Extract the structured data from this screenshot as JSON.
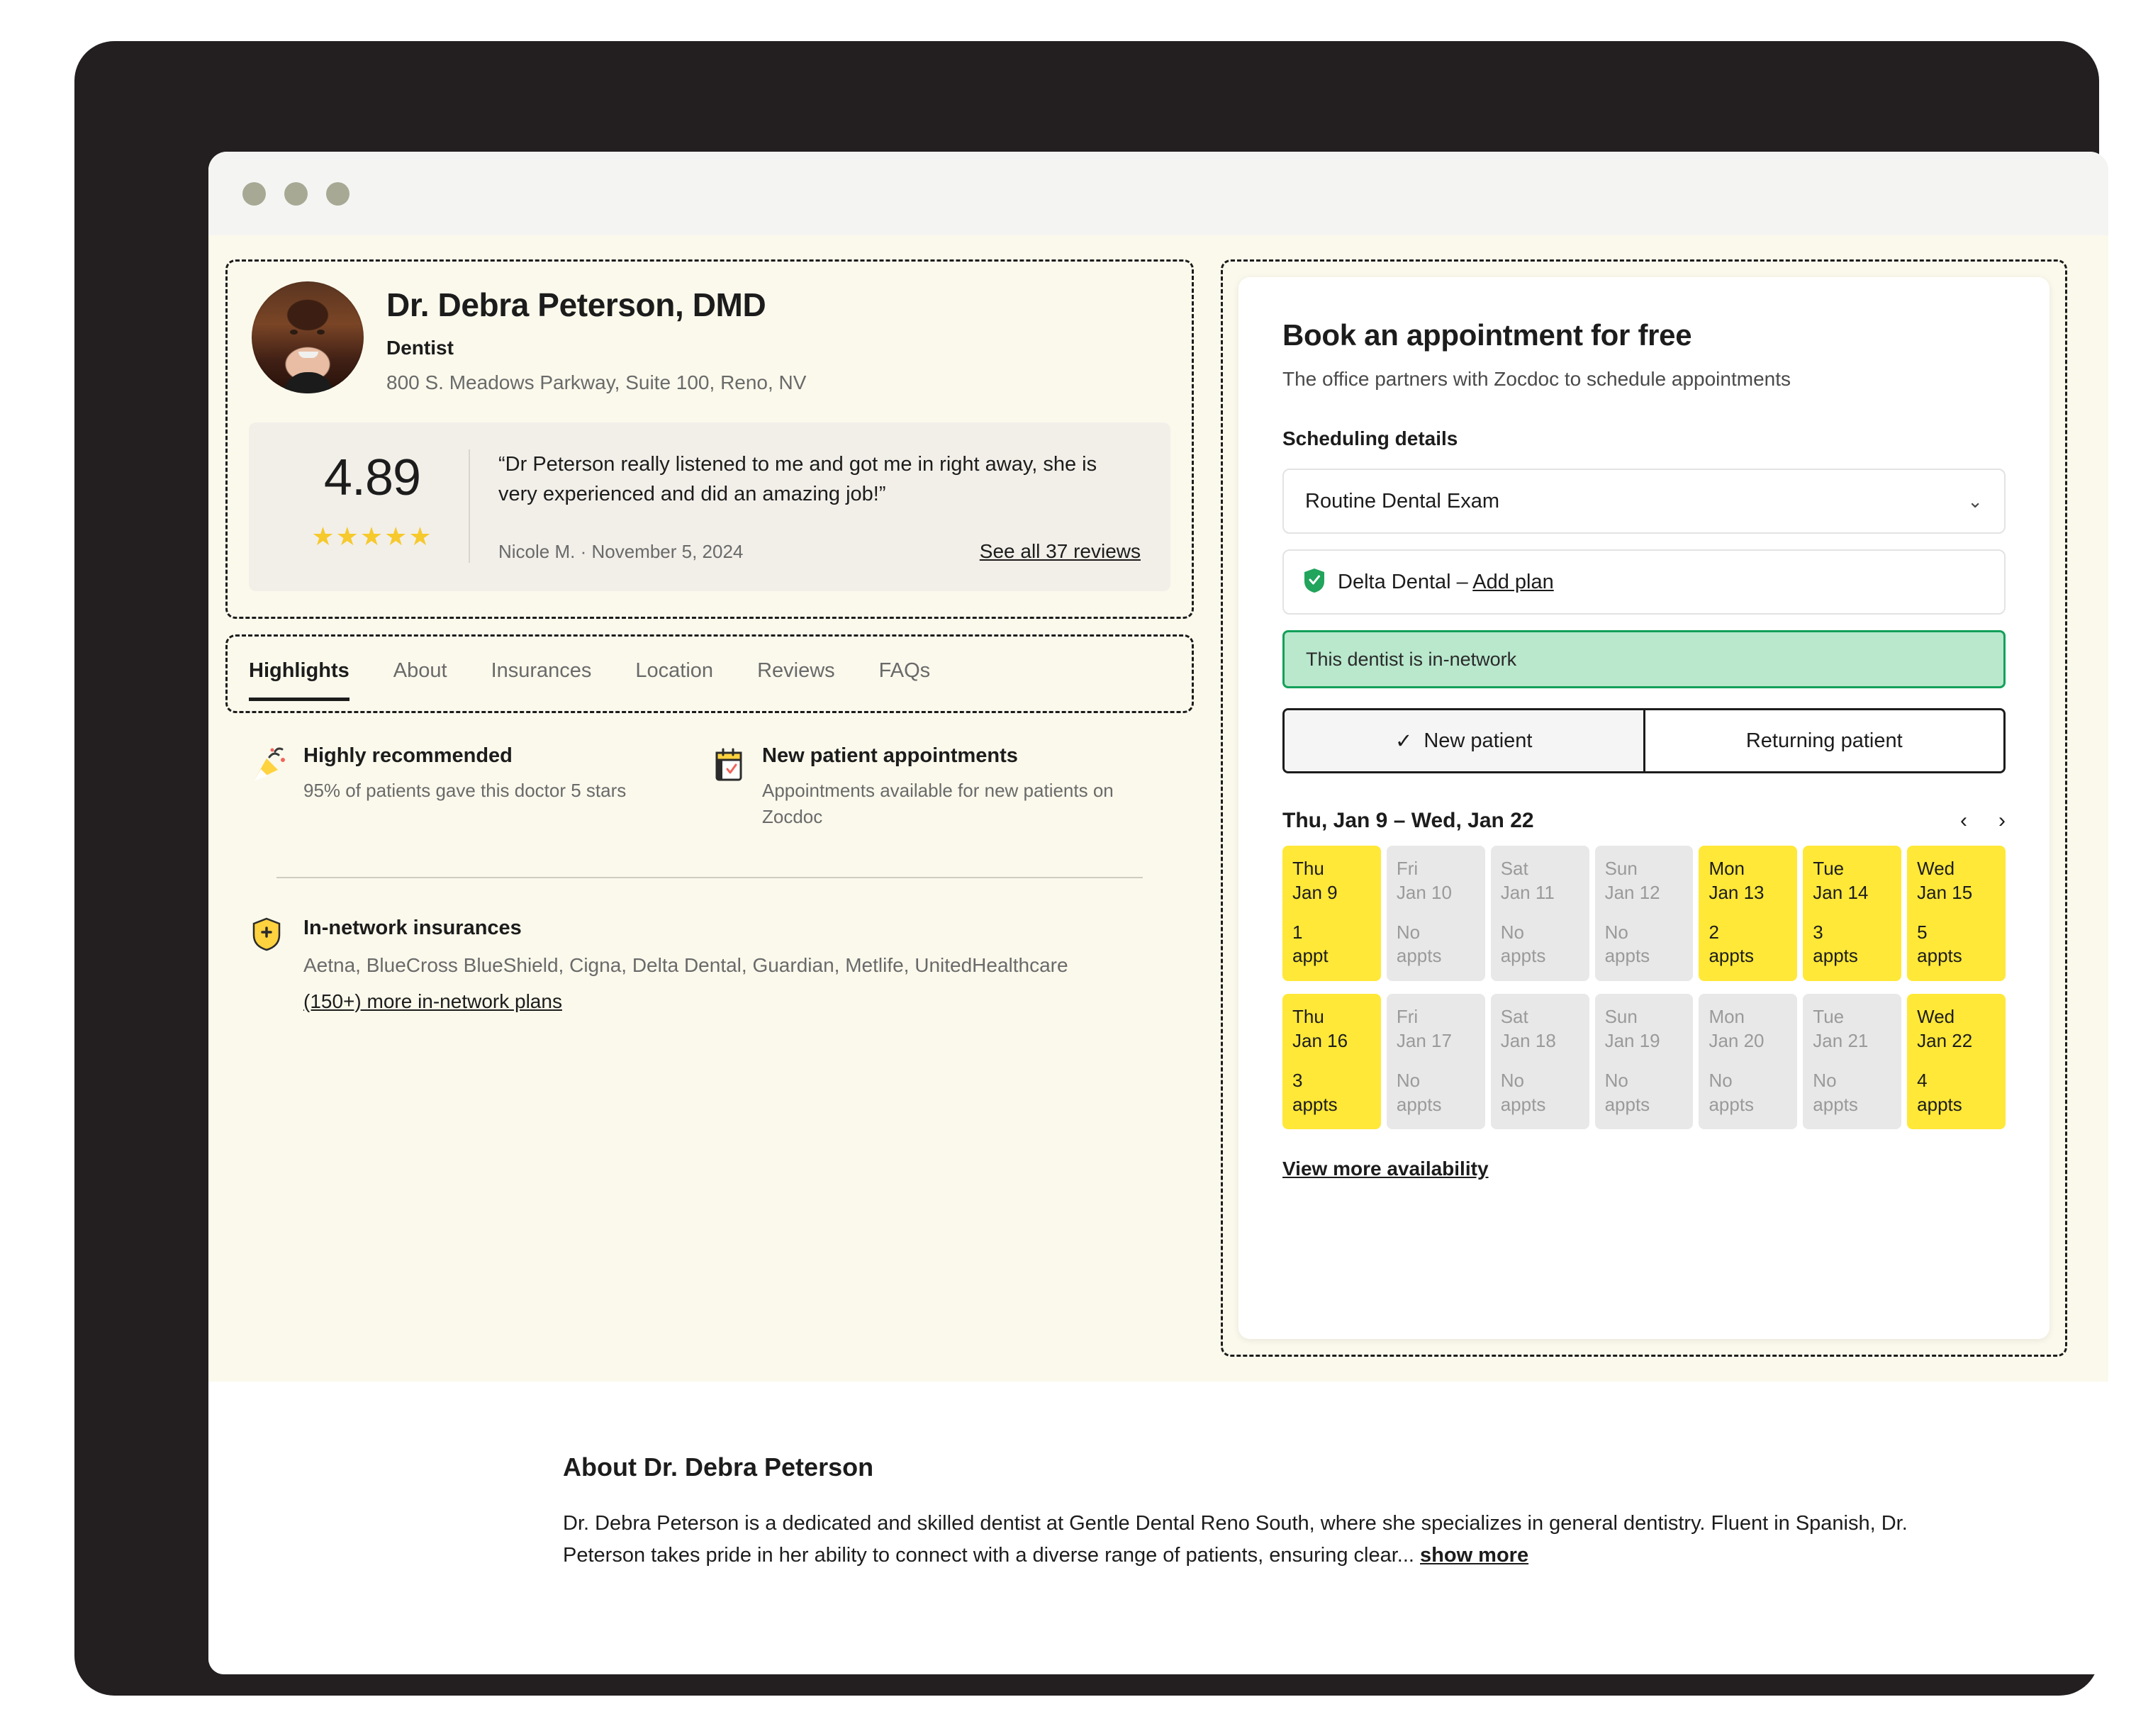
{
  "browser": {
    "dots": [
      "close-dot",
      "minimize-dot",
      "maximize-dot"
    ]
  },
  "profile": {
    "name": "Dr. Debra Peterson, DMD",
    "specialty": "Dentist",
    "address": "800 S. Meadows Parkway, Suite 100, Reno, NV"
  },
  "review": {
    "rating": "4.89",
    "stars": "★★★★★",
    "quote": "“Dr Peterson really listened to me and got me in right away, she is very experienced and did an amazing job!”",
    "author": "Nicole M.  ·  November 5, 2024",
    "see_all": "See all 37 reviews"
  },
  "tabs": [
    {
      "label": "Highlights",
      "active": true
    },
    {
      "label": "About",
      "active": false
    },
    {
      "label": "Insurances",
      "active": false
    },
    {
      "label": "Location",
      "active": false
    },
    {
      "label": "Reviews",
      "active": false
    },
    {
      "label": "FAQs",
      "active": false
    }
  ],
  "highlights": [
    {
      "icon": "party-popper-icon",
      "title": "Highly recommended",
      "desc": "95% of patients gave this doctor 5 stars"
    },
    {
      "icon": "calendar-check-icon",
      "title": "New patient appointments",
      "desc": "Appointments available for new patients on Zocdoc"
    }
  ],
  "insurance": {
    "icon": "shield-plus-icon",
    "title": "In-network insurances",
    "list": "Aetna, BlueCross BlueShield, Cigna, Delta Dental, Guardian, Metlife, UnitedHealthcare",
    "more_link": "(150+) more in-network plans"
  },
  "booking": {
    "title": "Book an appointment for free",
    "subtitle": "The office partners with Zocdoc to schedule appointments",
    "scheduling_label": "Scheduling details",
    "visit_type": "Routine Dental Exam",
    "plan_name": "Delta Dental – ",
    "add_plan": "Add plan",
    "network_status": "This dentist is in-network",
    "patient_types": [
      {
        "label": "New patient",
        "selected": true
      },
      {
        "label": "Returning patient",
        "selected": false
      }
    ],
    "week_range": "Thu, Jan 9 – Wed, Jan 22",
    "prev_icon": "chevron-left-icon",
    "next_icon": "chevron-right-icon",
    "view_more": "View more availability",
    "calendar": {
      "row1": [
        {
          "dow": "Thu",
          "date": "Jan 9",
          "count": "1",
          "unit": "appt",
          "available": true
        },
        {
          "dow": "Fri",
          "date": "Jan 10",
          "count": "No",
          "unit": "appts",
          "available": false
        },
        {
          "dow": "Sat",
          "date": "Jan 11",
          "count": "No",
          "unit": "appts",
          "available": false
        },
        {
          "dow": "Sun",
          "date": "Jan 12",
          "count": "No",
          "unit": "appts",
          "available": false
        },
        {
          "dow": "Mon",
          "date": "Jan 13",
          "count": "2",
          "unit": "appts",
          "available": true
        },
        {
          "dow": "Tue",
          "date": "Jan 14",
          "count": "3",
          "unit": "appts",
          "available": true
        },
        {
          "dow": "Wed",
          "date": "Jan 15",
          "count": "5",
          "unit": "appts",
          "available": true
        }
      ],
      "row2": [
        {
          "dow": "Thu",
          "date": "Jan 16",
          "count": "3",
          "unit": "appts",
          "available": true
        },
        {
          "dow": "Fri",
          "date": "Jan 17",
          "count": "No",
          "unit": "appts",
          "available": false
        },
        {
          "dow": "Sat",
          "date": "Jan 18",
          "count": "No",
          "unit": "appts",
          "available": false
        },
        {
          "dow": "Sun",
          "date": "Jan 19",
          "count": "No",
          "unit": "appts",
          "available": false
        },
        {
          "dow": "Mon",
          "date": "Jan 20",
          "count": "No",
          "unit": "appts",
          "available": false
        },
        {
          "dow": "Tue",
          "date": "Jan 21",
          "count": "No",
          "unit": "appts",
          "available": false
        },
        {
          "dow": "Wed",
          "date": "Jan 22",
          "count": "4",
          "unit": "appts",
          "available": true
        }
      ]
    }
  },
  "about": {
    "title": "About Dr. Debra Peterson",
    "body": "Dr. Debra Peterson is a dedicated and skilled dentist at Gentle Dental Reno South, where she specializes in general dentistry. Fluent in Spanish, Dr. Peterson takes pride in her ability to connect with a diverse range of patients, ensuring clear...",
    "show_more": "show more"
  },
  "colors": {
    "cream_bg": "#fbf9ec",
    "frame": "#231f20",
    "available_yellow": "#ffe838",
    "unavailable_gray": "#e8e8e8",
    "in_network_green": "#13a05a",
    "in_network_bg": "#b9e8cd",
    "star_gold": "#f6c92d"
  }
}
